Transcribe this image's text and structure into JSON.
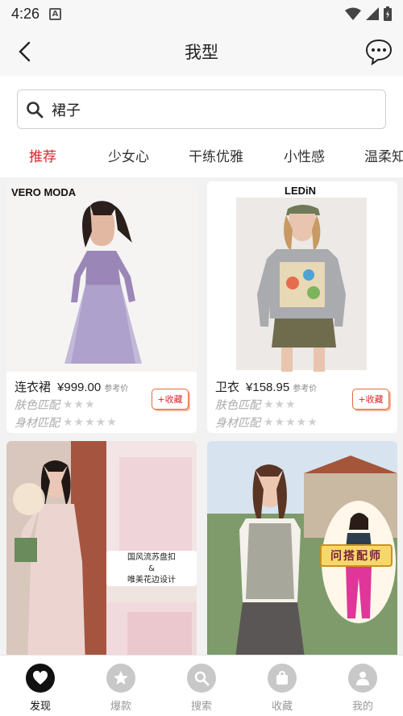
{
  "status": {
    "time": "4:26"
  },
  "header": {
    "title": "我型"
  },
  "search": {
    "value": "裙子"
  },
  "tabs": [
    "推荐",
    "少女心",
    "干练优雅",
    "小性感",
    "温柔知"
  ],
  "cards": [
    {
      "brand": "VERO MODA",
      "category": "连衣裙",
      "price": "¥999.00",
      "ref": "参考价",
      "skin_label": "肤色匹配",
      "skin_stars": 3,
      "body_label": "身材匹配",
      "body_stars": 5,
      "fav": "收藏"
    },
    {
      "brand": "LEDiN",
      "category": "卫衣",
      "price": "¥158.95",
      "ref": "参考价",
      "skin_label": "肤色匹配",
      "skin_stars": 3,
      "body_label": "身材匹配",
      "body_stars": 5,
      "fav": "收藏"
    },
    {
      "caption1": "国风流苏盘扣",
      "caption2": "&",
      "caption3": "唯美花边设计"
    },
    {
      "badge": "问搭配师"
    }
  ],
  "nav": [
    {
      "label": "发现",
      "icon": "heart-icon",
      "active": true
    },
    {
      "label": "爆款",
      "icon": "star-icon",
      "active": false
    },
    {
      "label": "搜索",
      "icon": "search-icon",
      "active": false
    },
    {
      "label": "收藏",
      "icon": "bag-icon",
      "active": false
    },
    {
      "label": "我的",
      "icon": "person-icon",
      "active": false
    }
  ]
}
